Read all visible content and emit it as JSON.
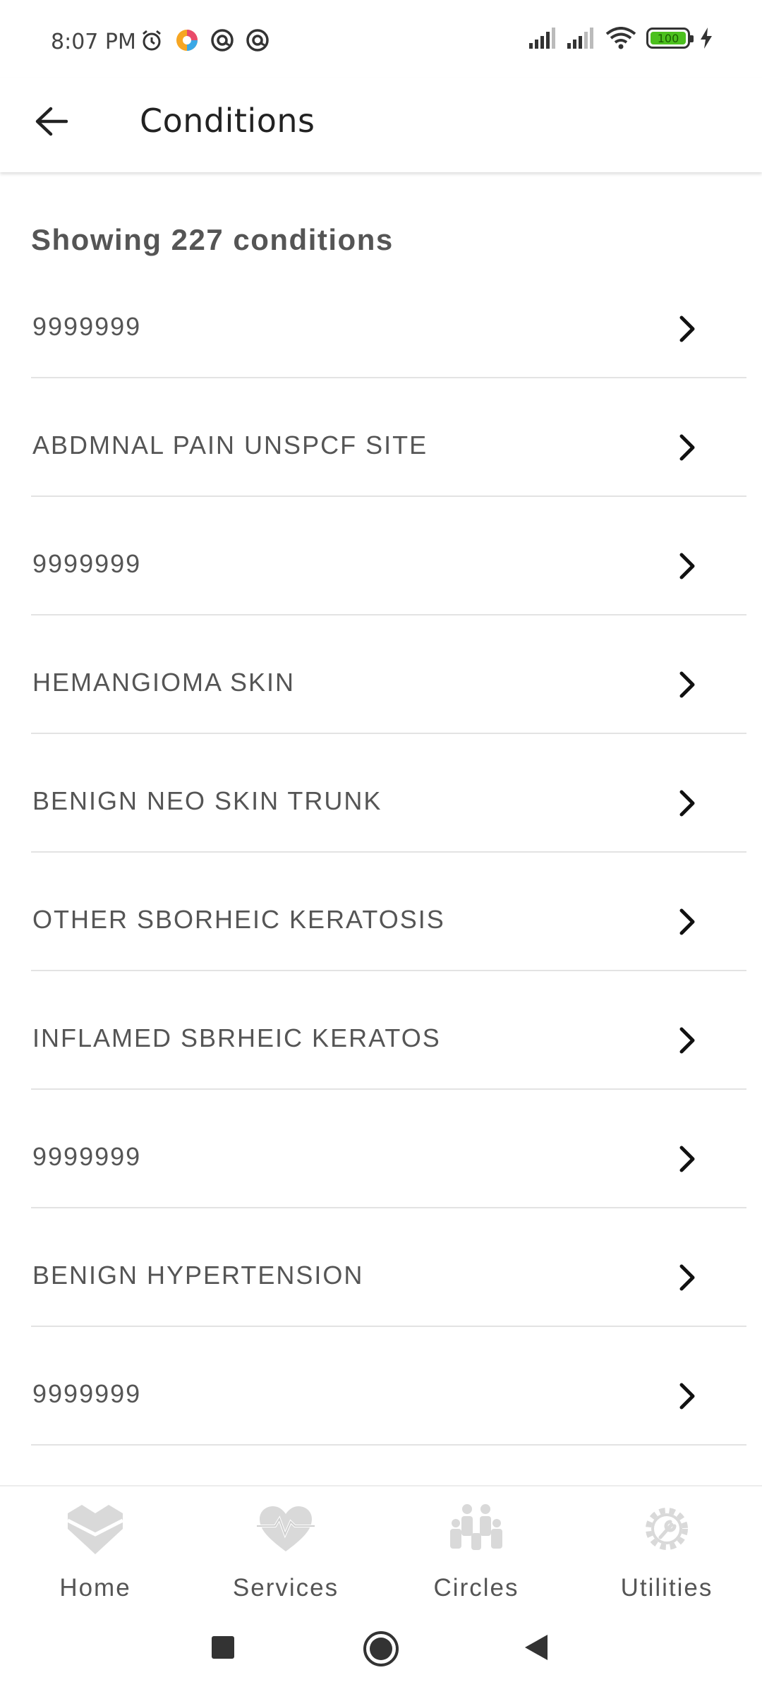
{
  "status_bar": {
    "time": "8:07 PM",
    "battery": "100",
    "left_icons": [
      "alarm-icon",
      "app-notification-icon",
      "at-sign-icon",
      "at-sign-icon"
    ],
    "right_icons": [
      "signal-icon",
      "signal-icon",
      "wifi-icon",
      "battery-icon",
      "charging-icon"
    ]
  },
  "app_bar": {
    "back_icon": "arrow-left-icon",
    "title": "Conditions"
  },
  "summary": "Showing 227 conditions",
  "conditions": [
    {
      "label": "9999999"
    },
    {
      "label": "ABDMNAL PAIN UNSPCF SITE"
    },
    {
      "label": "9999999"
    },
    {
      "label": "HEMANGIOMA SKIN"
    },
    {
      "label": "BENIGN NEO SKIN TRUNK"
    },
    {
      "label": "OTHER SBORHEIC KERATOSIS"
    },
    {
      "label": "INFLAMED SBRHEIC KERATOS"
    },
    {
      "label": "9999999"
    },
    {
      "label": "BENIGN HYPERTENSION"
    },
    {
      "label": "9999999"
    }
  ],
  "bottom_nav": {
    "items": [
      {
        "label": "Home",
        "icon": "home-heart-icon"
      },
      {
        "label": "Services",
        "icon": "heartbeat-icon"
      },
      {
        "label": "Circles",
        "icon": "people-icon"
      },
      {
        "label": "Utilities",
        "icon": "gear-wrench-icon"
      }
    ]
  },
  "colors": {
    "label_text": "#555555",
    "divider": "#e3e3e3",
    "nav_icon": "#d6d6d6",
    "battery_fill": "#4cc01e"
  }
}
